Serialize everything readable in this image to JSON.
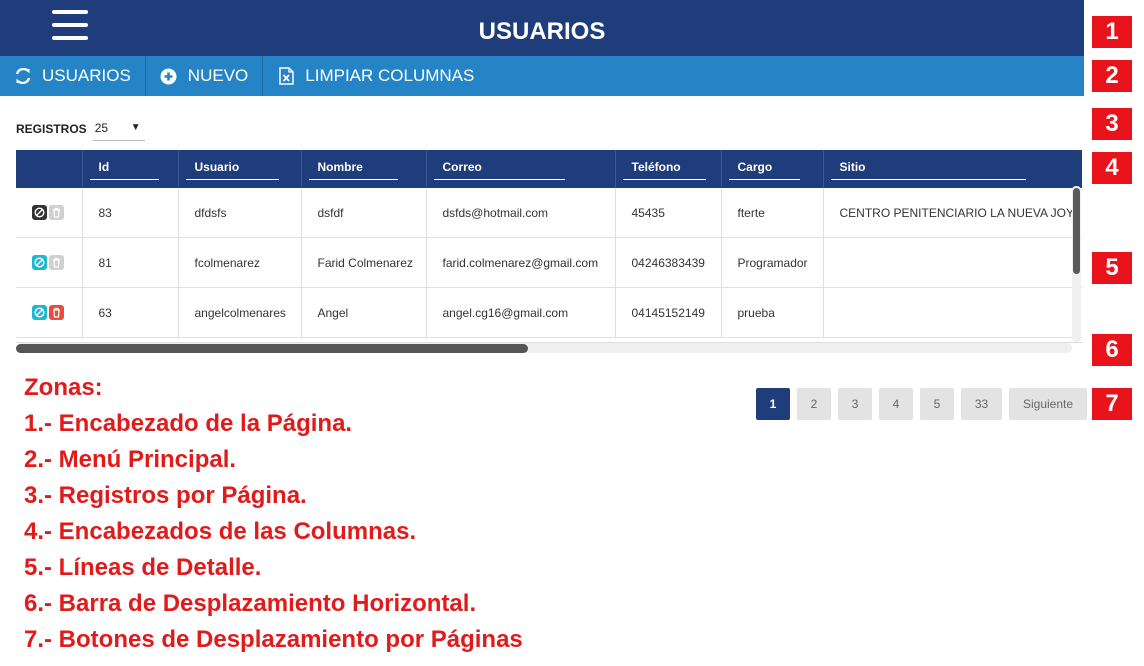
{
  "header": {
    "title": "USUARIOS",
    "menu_icon": "hamburger-menu-icon"
  },
  "menu": {
    "items": [
      {
        "label": "USUARIOS",
        "icon": "refresh-icon"
      },
      {
        "label": "NUEVO",
        "icon": "plus-circle-icon"
      },
      {
        "label": "LIMPIAR COLUMNAS",
        "icon": "excel-file-icon"
      }
    ]
  },
  "records": {
    "label": "REGISTROS",
    "value": "25"
  },
  "table": {
    "columns": [
      "Id",
      "Usuario",
      "Nombre",
      "Correo",
      "Teléfono",
      "Cargo",
      "Sitio"
    ],
    "rows": [
      {
        "id": "83",
        "usuario": "dfdsfs",
        "nombre": "dsfdf",
        "correo": "dsfds@hotmail.com",
        "telefono": "45435",
        "cargo": "fterte",
        "sitio": "CENTRO PENITENCIARIO LA NUEVA JOYA"
      },
      {
        "id": "81",
        "usuario": "fcolmenarez",
        "nombre": "Farid Colmenarez",
        "correo": "farid.colmenarez@gmail.com",
        "telefono": "04246383439",
        "cargo": "Programador",
        "sitio": ""
      },
      {
        "id": "63",
        "usuario": "angelcolmenares",
        "nombre": "Angel",
        "correo": "angel.cg16@gmail.com",
        "telefono": "04145152149",
        "cargo": "prueba",
        "sitio": ""
      }
    ]
  },
  "pagination": {
    "pages": [
      "1",
      "2",
      "3",
      "4",
      "5",
      "33"
    ],
    "current": "1",
    "next_label": "Siguiente"
  },
  "zones": [
    "1",
    "2",
    "3",
    "4",
    "5",
    "6",
    "7"
  ],
  "legend": {
    "title": "Zonas:",
    "items": [
      "1.- Encabezado de la Página.",
      "2.- Menú Principal.",
      "3.- Registros por Página.",
      "4.- Encabezados de las Columnas.",
      "5.- Líneas de Detalle.",
      "6.- Barra de Desplazamiento Horizontal.",
      "7.- Botones de Desplazamiento por Páginas"
    ]
  },
  "colors": {
    "header_bg": "#1f3d7a",
    "menu_bg": "#2484c6",
    "badge_bg": "#e8131b",
    "legend_text": "#e01b1b"
  }
}
